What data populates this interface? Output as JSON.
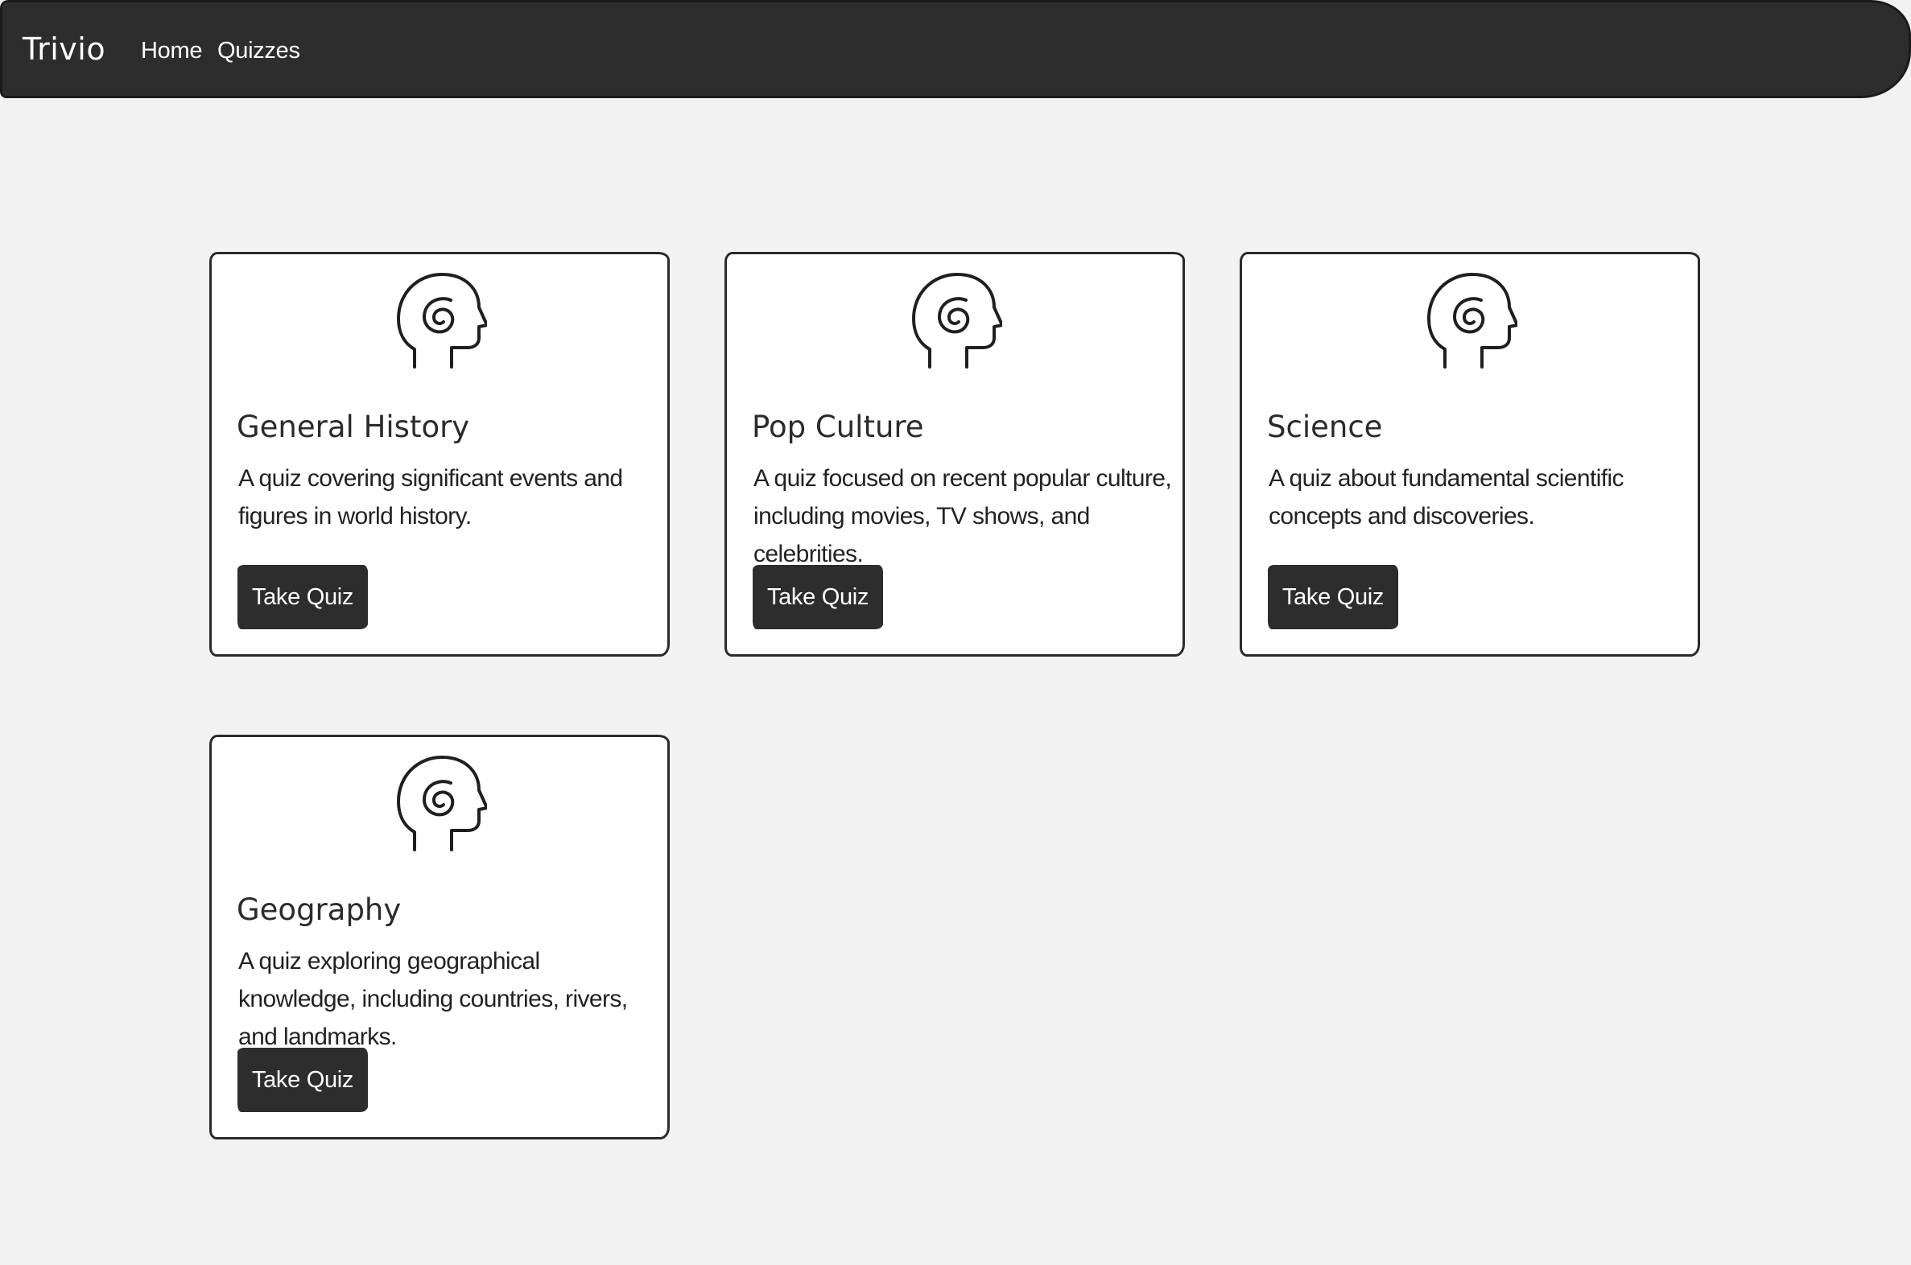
{
  "navbar": {
    "brand": "Trivio",
    "links": [
      {
        "label": "Home"
      },
      {
        "label": "Quizzes"
      }
    ]
  },
  "quizzes": [
    {
      "icon": "head-spiral-icon",
      "title": "General History",
      "description": "A quiz covering significant events and figures in world history.",
      "button_label": "Take Quiz"
    },
    {
      "icon": "head-spiral-icon",
      "title": "Pop Culture",
      "description": "A quiz focused on recent popular culture, including movies, TV shows, and celebrities.",
      "button_label": "Take Quiz"
    },
    {
      "icon": "head-spiral-icon",
      "title": "Science",
      "description": "A quiz about fundamental scientific concepts and discoveries.",
      "button_label": "Take Quiz"
    },
    {
      "icon": "head-spiral-icon",
      "title": "Geography",
      "description": "A quiz exploring geographical knowledge, including countries, rivers, and landmarks.",
      "button_label": "Take Quiz"
    }
  ],
  "colors": {
    "navbar_bg": "#2d2d2d",
    "page_bg": "#f2f2f2",
    "card_bg": "#ffffff",
    "button_bg": "#2d2d2d",
    "text": "#222222"
  }
}
